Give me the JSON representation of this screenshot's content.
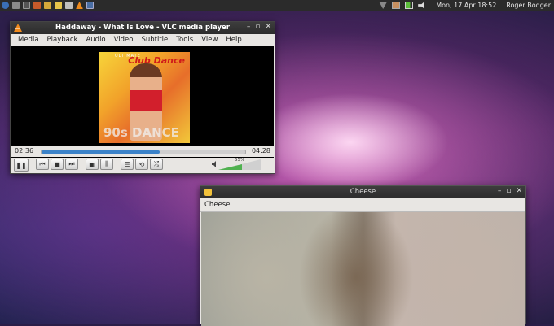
{
  "panel": {
    "datetime": "Mon, 17 Apr  18:52",
    "user": "Roger Bodger",
    "launcher_icons": [
      "menu-icon",
      "files-icon",
      "terminal-icon",
      "browser-icon",
      "folder-icon",
      "editor-icon",
      "text-icon",
      "vlc-icon",
      "active-window-icon"
    ],
    "tray_icons": [
      "network-icon",
      "user-icon",
      "battery-icon",
      "volume-icon"
    ]
  },
  "vlc": {
    "title": "Haddaway - What Is Love - VLC media player",
    "menu": [
      "Media",
      "Playback",
      "Audio",
      "Video",
      "Subtitle",
      "Tools",
      "View",
      "Help"
    ],
    "album_art": {
      "top_text": "ULTIMATE",
      "title": "Club Dance",
      "bottom_text": "90s DANCE"
    },
    "elapsed": "02:36",
    "total": "04:28",
    "progress": 0.58,
    "volume_label": "55%",
    "volume": 0.55,
    "controls": [
      "pause-icon",
      "previous-icon",
      "stop-icon",
      "next-icon",
      "fullscreen-icon",
      "extended-settings-icon",
      "playlist-icon",
      "loop-icon",
      "shuffle-icon"
    ]
  },
  "cheese": {
    "title": "Cheese",
    "menu": [
      "Cheese"
    ]
  },
  "colors": {
    "panel": "#2b2b2b",
    "titlebar": "#333333",
    "seek": "#3b82c8",
    "volume": "#4fb14f"
  }
}
